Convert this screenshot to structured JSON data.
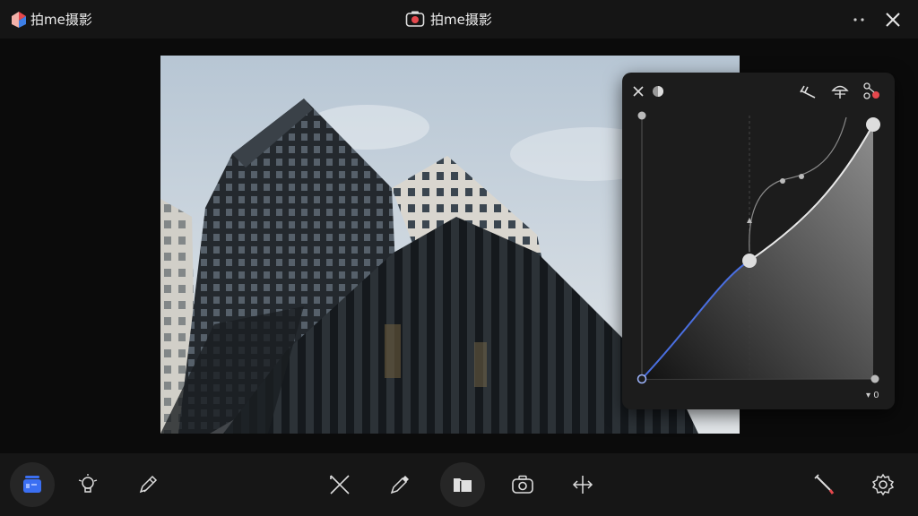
{
  "app": {
    "name": "拍me摄影",
    "window_title": "拍me摄影"
  },
  "icons": {
    "app_logo": "app-logo-icon",
    "window_title_icon": "camera-icon",
    "more": "more-dots-icon",
    "close": "close-icon"
  },
  "curve_panel": {
    "value_label": "▾ 0",
    "tools": [
      "close-icon",
      "channel-icon",
      "rake-tool-icon",
      "umbrella-tool-icon",
      "node-tool-icon"
    ]
  },
  "toolbar": {
    "left": [
      "adjust-panel-icon",
      "bulb-icon",
      "pen-edit-icon"
    ],
    "center": [
      "crop-cross-icon",
      "dropper-icon",
      "folder-icon",
      "camera-icon",
      "compare-icon"
    ],
    "right": [
      "brush-icon",
      "settings-icon"
    ]
  },
  "colors": {
    "accent_blue": "#4a6fe0",
    "logo_red": "#e5484d",
    "background": "#0a0a0a"
  }
}
